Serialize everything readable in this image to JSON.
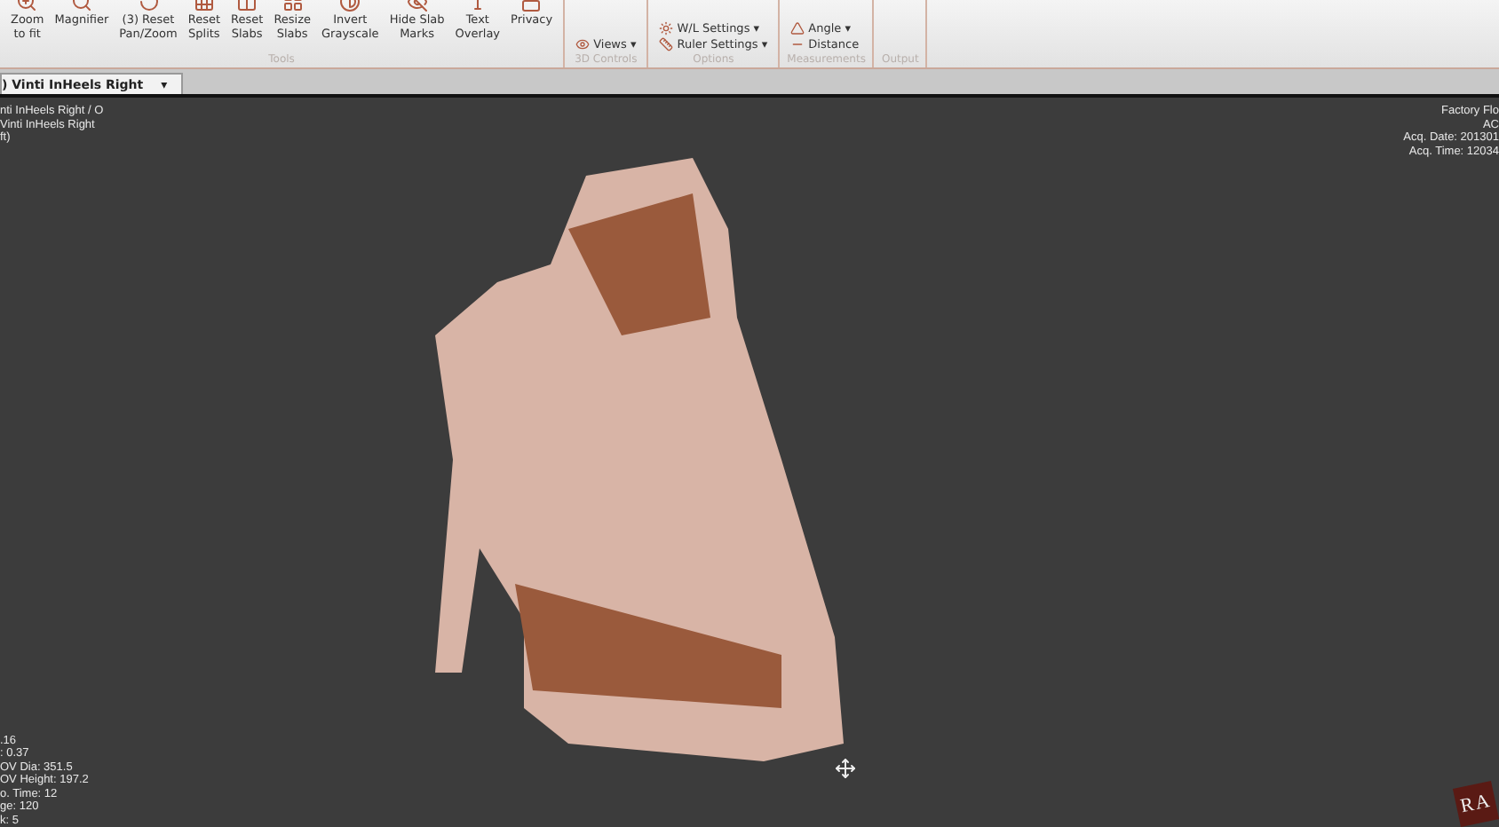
{
  "ribbon": {
    "groups": [
      {
        "label": "Tools",
        "kind": "buttons",
        "items": [
          "Zoom\nto fit",
          "Magnifier",
          "(3) Reset\nPan/Zoom",
          "Reset\nSplits",
          "Reset\nSlabs",
          "Resize\nSlabs",
          "Invert\nGrayscale",
          "Hide Slab\nMarks",
          "Text\nOverlay",
          "Privacy"
        ]
      },
      {
        "label": "3D Controls",
        "kind": "list",
        "items": [
          {
            "label": "Views",
            "caret": "▾"
          }
        ]
      },
      {
        "label": "Options",
        "kind": "list",
        "items": [
          {
            "label": "W/L Settings",
            "caret": "▾"
          },
          {
            "label": "Ruler Settings",
            "caret": "▾"
          }
        ]
      },
      {
        "label": "Measurements",
        "kind": "list",
        "items": [
          {
            "label": "Angle",
            "caret": "▾"
          },
          {
            "label": "Distance"
          }
        ]
      },
      {
        "label": "Output",
        "kind": "list"
      }
    ]
  },
  "tabs": [
    {
      "label": ") Vinti InHeels Right",
      "pin": "▾",
      "selected": true
    }
  ],
  "viewport": {
    "top_left": [
      "nti InHeels Right / O",
      "Vinti InHeels Right",
      "ft)"
    ],
    "top_right": [
      "Factory Flo",
      "AC",
      "Acq. Date: 201301",
      "Acq. Time: 12034"
    ],
    "bottom_left": [
      ".16",
      ": 0.37",
      "OV Dia: 351.5",
      "OV Height: 197.2",
      "o. Time: 12",
      "ge: 120",
      "k: 5"
    ],
    "cube": "RA"
  }
}
